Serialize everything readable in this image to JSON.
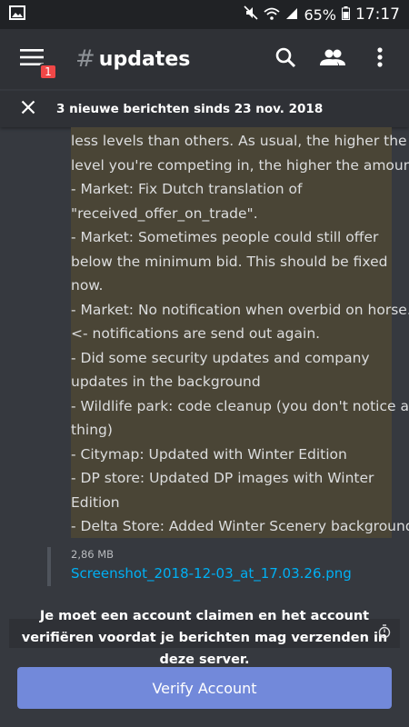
{
  "status_bar": {
    "battery": "65%",
    "time": "17:17",
    "icons": [
      "image-icon",
      "mute-icon",
      "wifi-icon",
      "signal-icon",
      "battery-icon"
    ]
  },
  "header": {
    "menu_badge": "1",
    "channel_hash": "#",
    "channel_name": "updates",
    "icons": [
      "menu-icon",
      "search-icon",
      "members-icon",
      "more-vertical-icon"
    ]
  },
  "new_messages_bar": {
    "text": "3 nieuwe berichten sinds 23 nov. 2018"
  },
  "message": {
    "lines": [
      "less levels than others. As usual, the higher the",
      "level you're competing in, the higher the amount.",
      "- Market: Fix Dutch translation of",
      "\"received_offer_on_trade\".",
      "- Market: Sometimes people could still offer",
      "below the minimum bid. This should be fixed",
      "now.",
      "- Market: No notification when overbid on horse.",
      "<- notifications are send out again.",
      "- Did some security updates and company",
      "updates in the background",
      "- Wildlife park: code cleanup (you don't notice a",
      "thing)",
      "- Citymap: Updated with Winter Edition",
      "- DP store: Updated DP images with Winter",
      "Edition",
      "- Delta Store: Added Winter Scenery background"
    ],
    "attachment": {
      "size": "2,86 MB",
      "filename": "Screenshot_2018-12-03_at_17.03.26.png"
    }
  },
  "footer": {
    "claim_text": "Je moet een account claimen en het account verifiëren voordat je berichten mag verzenden in deze server.",
    "verify_button": "Verify Account"
  },
  "colors": {
    "background": "#36393f",
    "header": "#2f3136",
    "highlight": "#4a4536",
    "link": "#00b0f4",
    "accent": "#7289da",
    "badge": "#f04747"
  }
}
